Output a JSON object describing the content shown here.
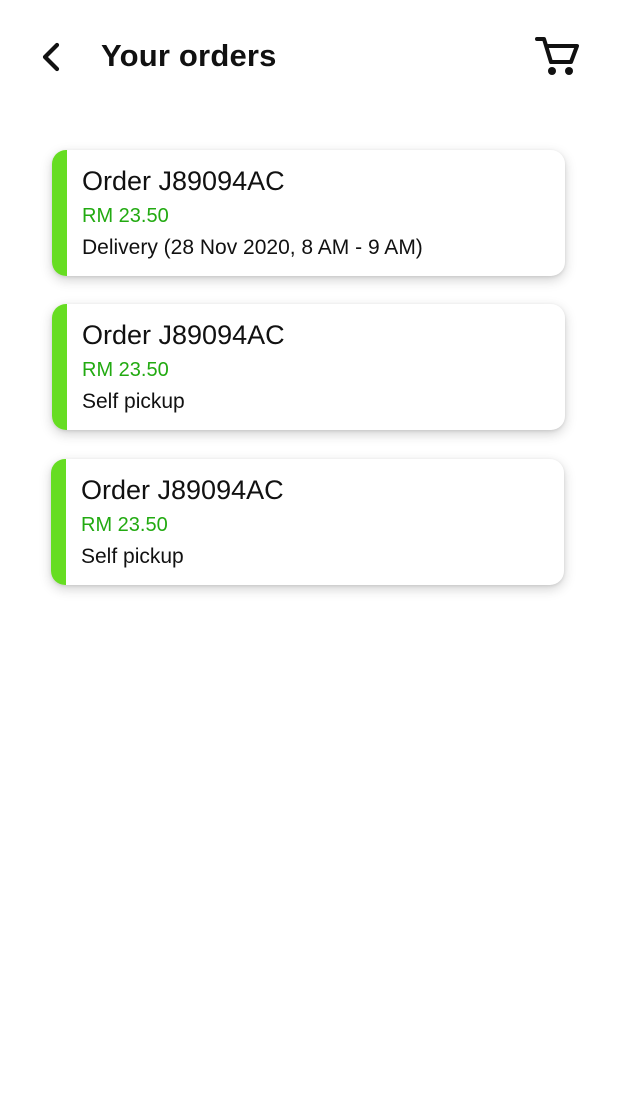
{
  "header": {
    "title": "Your orders",
    "back_icon": "chevron-left-icon",
    "cart_icon": "cart-icon"
  },
  "colors": {
    "accent": "#66dd22",
    "price": "#22aa11",
    "text": "#111111"
  },
  "orders": [
    {
      "title": "Order J89094AC",
      "price": "RM 23.50",
      "method": "Delivery (28 Nov 2020, 8 AM - 9 AM)"
    },
    {
      "title": "Order J89094AC",
      "price": "RM 23.50",
      "method": "Self pickup"
    },
    {
      "title": "Order J89094AC",
      "price": "RM 23.50",
      "method": "Self pickup"
    }
  ]
}
